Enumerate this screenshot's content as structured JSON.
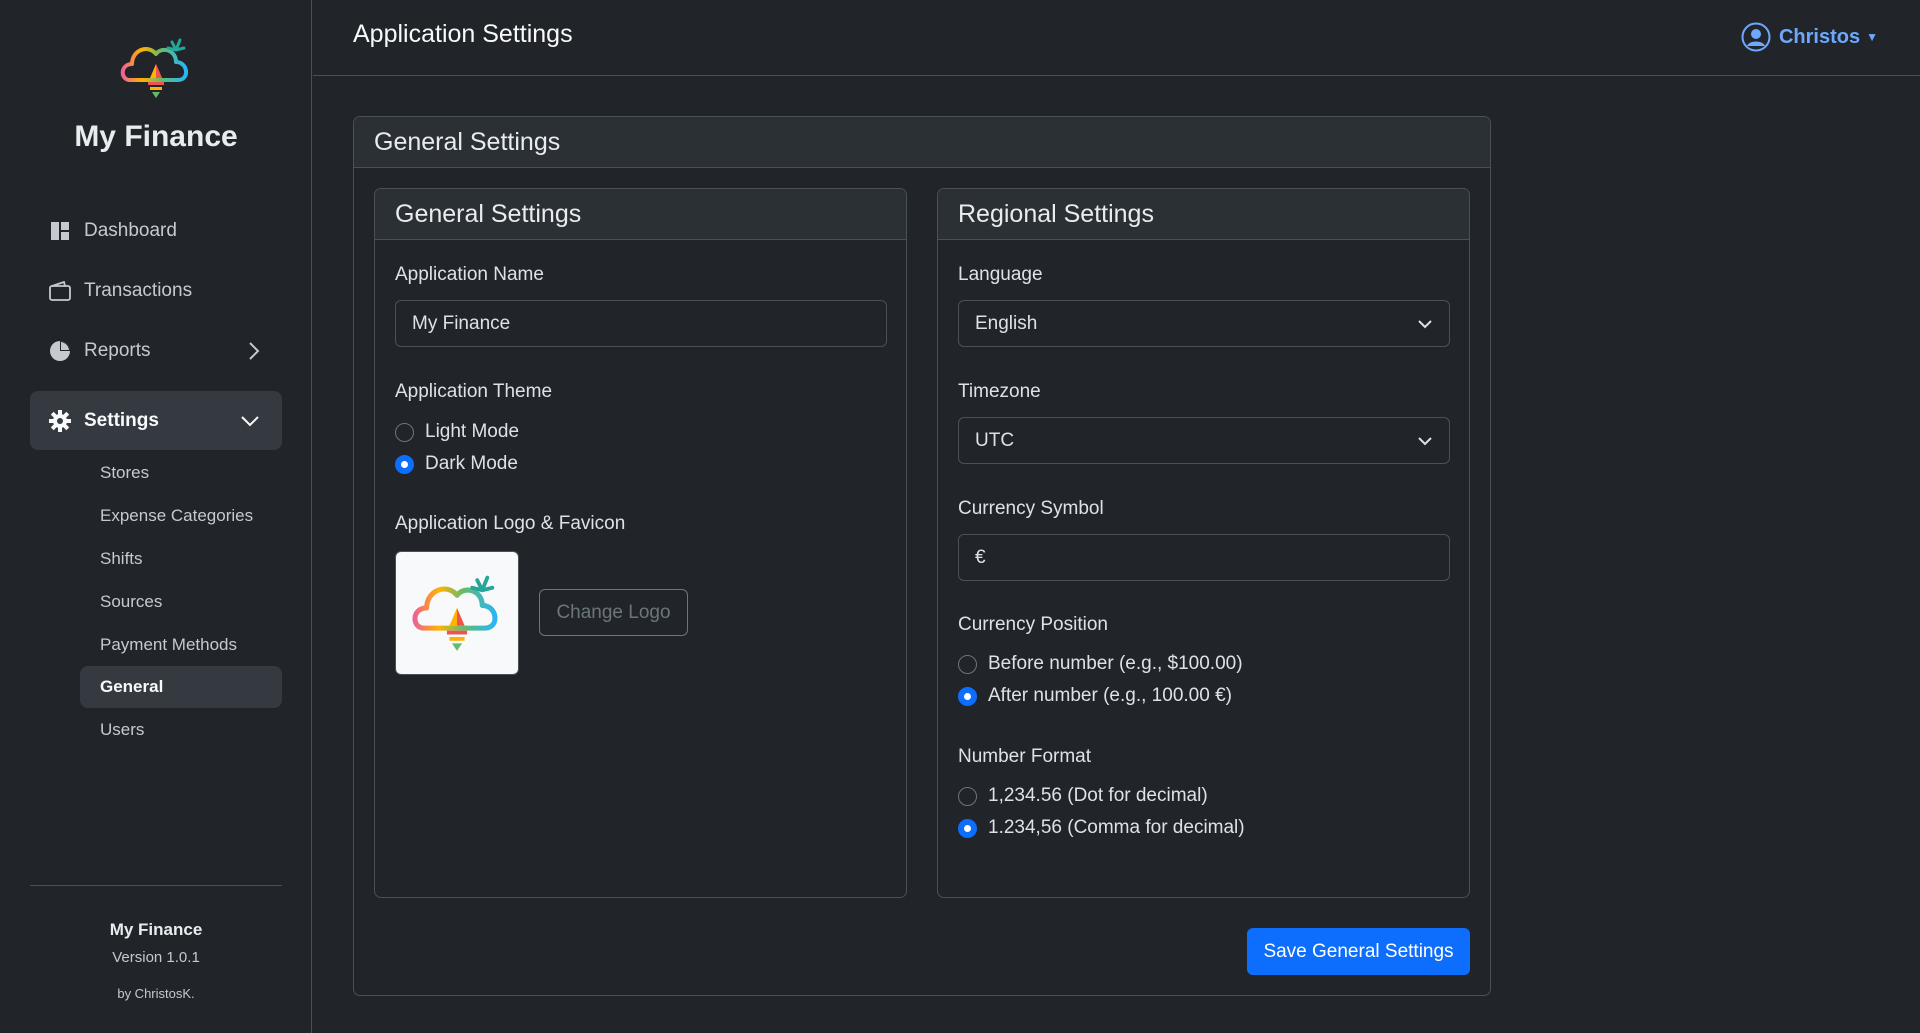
{
  "app": {
    "name": "My Finance",
    "version": "Version 1.0.1",
    "author": "by ChristosK."
  },
  "sidebar": {
    "nav": [
      {
        "label": "Dashboard",
        "icon": "dashboard-icon"
      },
      {
        "label": "Transactions",
        "icon": "wallet-icon"
      },
      {
        "label": "Reports",
        "icon": "pie-chart-icon"
      },
      {
        "label": "Settings",
        "icon": "gear-icon"
      }
    ],
    "settings_sub": [
      "Stores",
      "Expense Categories",
      "Shifts",
      "Sources",
      "Payment Methods",
      "General",
      "Users"
    ],
    "active_sub": "General"
  },
  "header": {
    "title": "Application Settings",
    "user": "Christos"
  },
  "outer_card": {
    "title": "General Settings"
  },
  "general": {
    "title": "General Settings",
    "app_name_label": "Application Name",
    "app_name_value": "My Finance",
    "theme_label": "Application Theme",
    "theme_options": [
      "Light Mode",
      "Dark Mode"
    ],
    "theme_selected": "Dark Mode",
    "logo_label": "Application Logo & Favicon",
    "change_logo": "Change Logo"
  },
  "regional": {
    "title": "Regional Settings",
    "language_label": "Language",
    "language_value": "English",
    "timezone_label": "Timezone",
    "timezone_value": "UTC",
    "currency_symbol_label": "Currency Symbol",
    "currency_symbol_value": "€",
    "currency_position_label": "Currency Position",
    "currency_position_options": [
      "Before number (e.g., $100.00)",
      "After number (e.g., 100.00 €)"
    ],
    "currency_position_selected": "After number (e.g., 100.00 €)",
    "number_format_label": "Number Format",
    "number_format_options": [
      "1,234.56 (Dot for decimal)",
      "1.234,56 (Comma for decimal)"
    ],
    "number_format_selected": "1.234,56 (Comma for decimal)"
  },
  "save_button": "Save General Settings",
  "colors": {
    "accent": "#0d6efd",
    "link": "#6ea8fe",
    "background": "#212529",
    "border": "#495057"
  }
}
